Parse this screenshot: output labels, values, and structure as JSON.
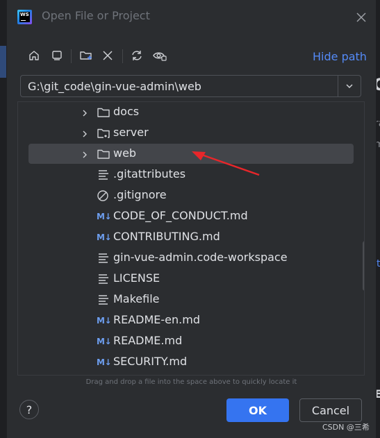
{
  "dialog": {
    "title": "Open File or Project",
    "hide_path": "Hide path",
    "path_value": "G:\\git_code\\gin-vue-admin\\web",
    "hint": "Drag and drop a file into the space above to quickly locate it",
    "help": "?",
    "ok": "OK",
    "cancel": "Cancel"
  },
  "app_logo_text": "WS",
  "toolbar_icons": [
    "home-icon",
    "desktop-icon",
    "new-folder-icon",
    "delete-icon",
    "refresh-icon",
    "show-hidden-icon"
  ],
  "tree": {
    "rows": [
      {
        "label": "docs",
        "type": "folder",
        "expandable": true
      },
      {
        "label": "server",
        "type": "folder-module",
        "expandable": true
      },
      {
        "label": "web",
        "type": "folder",
        "expandable": true,
        "selected": true
      },
      {
        "label": ".gitattributes",
        "type": "text"
      },
      {
        "label": ".gitignore",
        "type": "ignore"
      },
      {
        "label": "CODE_OF_CONDUCT.md",
        "type": "markdown"
      },
      {
        "label": "CONTRIBUTING.md",
        "type": "markdown"
      },
      {
        "label": "gin-vue-admin.code-workspace",
        "type": "text"
      },
      {
        "label": "LICENSE",
        "type": "text"
      },
      {
        "label": "Makefile",
        "type": "text"
      },
      {
        "label": "README-en.md",
        "type": "markdown"
      },
      {
        "label": "README.md",
        "type": "markdown"
      },
      {
        "label": "SECURITY.md",
        "type": "markdown"
      }
    ],
    "md_icon_text": "M↓"
  },
  "watermark": "CSDN @三希",
  "colors": {
    "accent": "#3574f0",
    "link": "#548af7",
    "selection": "#43454a",
    "annotation": "#e8262a"
  }
}
